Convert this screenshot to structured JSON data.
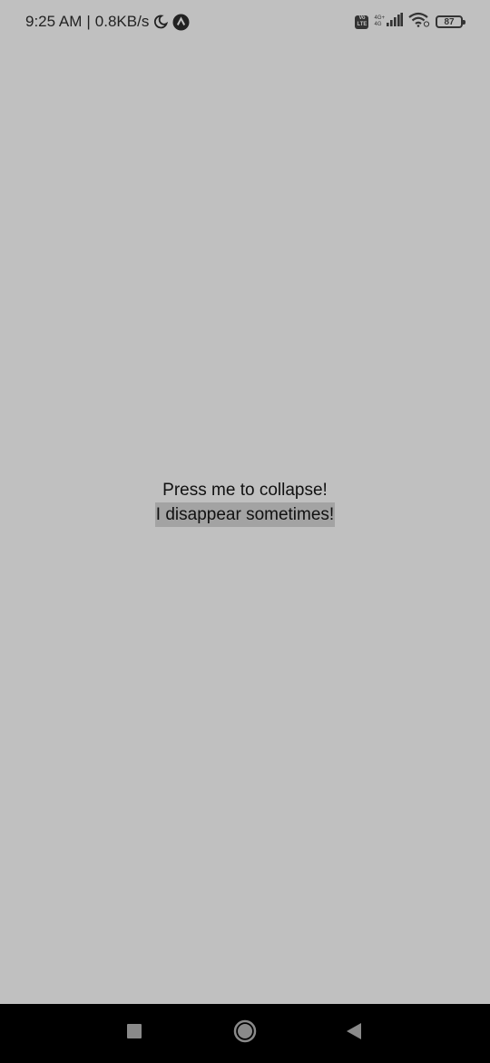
{
  "status_bar": {
    "time": "9:25 AM",
    "separator": "|",
    "network_speed": "0.8KB/s",
    "icons": [
      "moon-icon",
      "app-notification-icon",
      "volte-icon",
      "signal-icon",
      "wifi-icon",
      "battery-icon"
    ],
    "volte_label_top": "Vo",
    "volte_label_bottom": "LTE",
    "network_type_top": "4G+",
    "network_type_bottom": "4G",
    "battery_level": "87"
  },
  "main": {
    "collapse_button_label": "Press me to collapse!",
    "collapsible_text": "I disappear sometimes!"
  },
  "nav_bar": {
    "buttons": [
      "recents-button",
      "home-button",
      "back-button"
    ]
  },
  "colors": {
    "background": "#c0c0c0",
    "highlight": "#a3a3a3",
    "nav_bar": "#000000"
  }
}
